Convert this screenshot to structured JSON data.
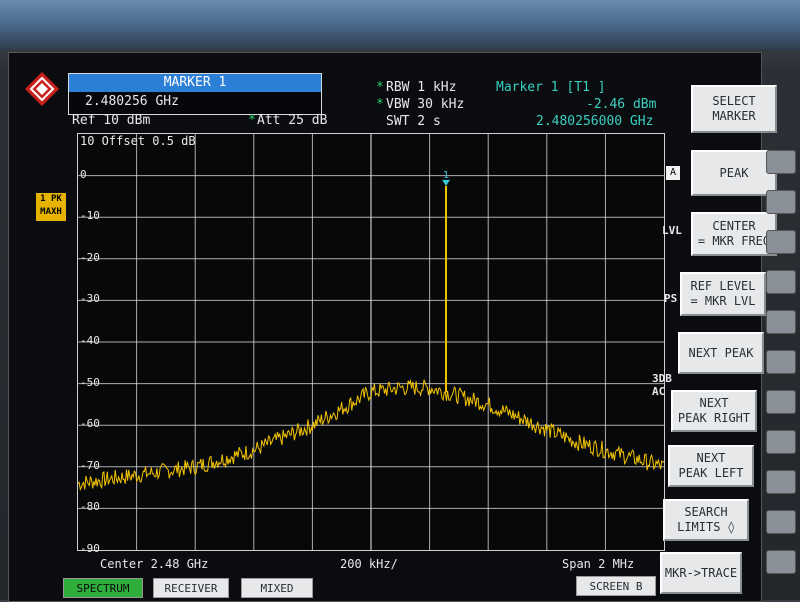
{
  "marker_box": {
    "title": "MARKER 1",
    "freq": "2.480256 GHz"
  },
  "settings": {
    "ref": "Ref  10 dBm",
    "att_star": "*",
    "att": "Att  25 dB",
    "rbw_star": "*",
    "rbw": "RBW 1 kHz",
    "vbw_star": "*",
    "vbw": "VBW 30 kHz",
    "swt": "SWT 2 s"
  },
  "marker_readout": {
    "title": "Marker 1 [T1 ]",
    "level": "-2.46 dBm",
    "freq": "2.480256000 GHz"
  },
  "offset_label": "10 Offset  0.5 dB",
  "trace_badge": {
    "line1": "1 PK",
    "line2": "MAXH"
  },
  "side_indicators": {
    "a": "A",
    "lvl": "LVL",
    "ps": "PS",
    "db3": "3DB",
    "ac": "AC"
  },
  "marker_flag": "1",
  "x_axis": {
    "center": "Center 2.48 GHz",
    "div": "200 kHz/",
    "span": "Span 2 MHz"
  },
  "softkeys": {
    "select_marker": [
      "SELECT",
      "MARKER"
    ],
    "peak": [
      "PEAK"
    ],
    "center": [
      "CENTER",
      "= MKR FREQ"
    ],
    "ref_level": [
      "REF LEVEL",
      "= MKR  LVL"
    ],
    "next_peak": [
      "NEXT PEAK"
    ],
    "next_peak_right": [
      "NEXT",
      "PEAK RIGHT"
    ],
    "next_peak_left": [
      "NEXT",
      "PEAK LEFT"
    ],
    "search_limits": [
      "SEARCH",
      "LIMITS ◊"
    ],
    "mkr_trace": [
      "MKR->TRACE"
    ]
  },
  "bottom_tabs": {
    "spectrum": "SPECTRUM",
    "receiver": "RECEIVER",
    "mixed": "MIXED",
    "screen_b": "SCREEN B"
  },
  "colors": {
    "trace": "#f2c300",
    "marker": "#39c8d8",
    "grid": "#d8d8d8",
    "accent_bar": "#2c7fd6"
  },
  "chart_data": {
    "type": "line",
    "xlabel": "",
    "ylabel": "",
    "ylim": [
      -90,
      10
    ],
    "yticks": [
      "0",
      "-10",
      "-20",
      "-30",
      "-40",
      "-50",
      "-60",
      "-70",
      "-80",
      "-90"
    ],
    "ytick_values": [
      0,
      -10,
      -20,
      -30,
      -40,
      -50,
      -60,
      -70,
      -80,
      -90
    ],
    "x_center_ghz": 2.48,
    "x_span_mhz": 2,
    "x_divisions": 10,
    "series": [
      {
        "x_mhz_offset": [
          -1.0,
          -0.9,
          -0.8,
          -0.7,
          -0.6,
          -0.5,
          -0.4,
          -0.3,
          -0.2,
          -0.1,
          0.0,
          0.1,
          0.2,
          0.3,
          0.4,
          0.5,
          0.6,
          0.7,
          0.8,
          0.9,
          1.0
        ],
        "values_dbm": [
          -74,
          -73,
          -72,
          -71,
          -70,
          -68,
          -66,
          -63,
          -60,
          -56,
          -52,
          -51,
          -51,
          -53,
          -55,
          -58,
          -61,
          -64,
          -66,
          -68,
          -70
        ]
      }
    ],
    "marker": {
      "x_mhz_offset": 0.256,
      "value_dbm": -2.46
    }
  }
}
